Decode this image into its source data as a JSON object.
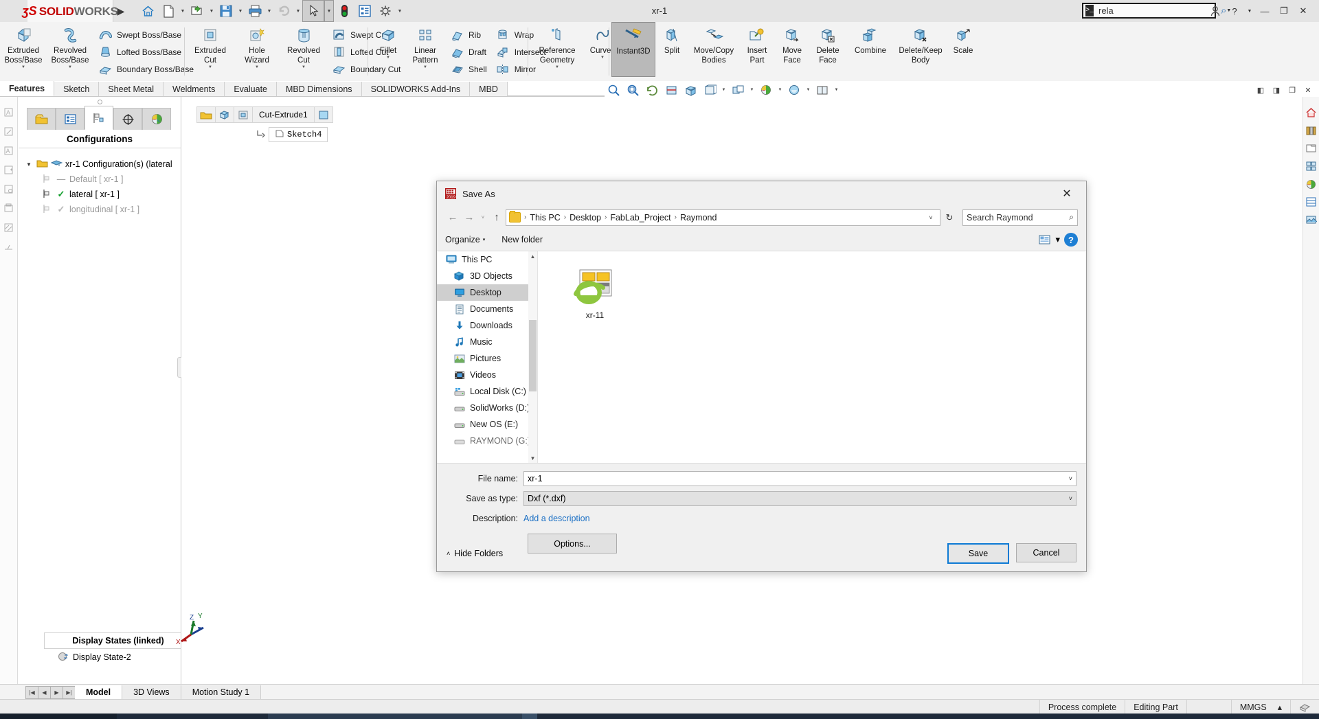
{
  "titlebar": {
    "brand_ds": "ʒS",
    "brand_solid": "SOLID",
    "brand_works": "WORKS",
    "document_title": "xr-1",
    "expand_arrow": "▶",
    "search_value": "rela",
    "quick_access": [
      {
        "name": "home-icon",
        "label": "Home"
      },
      {
        "name": "new-document-icon",
        "label": "New"
      },
      {
        "name": "open-folder-icon",
        "label": "Open"
      },
      {
        "name": "save-icon",
        "label": "Save"
      },
      {
        "name": "print-icon",
        "label": "Print"
      },
      {
        "name": "undo-icon",
        "label": "Undo"
      },
      {
        "name": "select-cursor-icon",
        "label": "Select"
      },
      {
        "name": "rebuild-icon",
        "label": "Rebuild"
      },
      {
        "name": "options-list-icon",
        "label": "File Properties"
      },
      {
        "name": "gear-icon",
        "label": "Options"
      }
    ],
    "window_controls": [
      "account-icon",
      "help-icon",
      "help-dropdown",
      "minimize",
      "restore",
      "close"
    ]
  },
  "ribbon": {
    "groups": [
      {
        "big": [
          {
            "label1": "Extruded",
            "label2": "Boss/Base",
            "icon": "extruded-boss-icon"
          },
          {
            "label1": "Revolved",
            "label2": "Boss/Base",
            "icon": "revolved-boss-icon"
          }
        ],
        "small": [
          {
            "label": "Swept Boss/Base",
            "icon": "swept-boss-icon"
          },
          {
            "label": "Lofted Boss/Base",
            "icon": "lofted-boss-icon"
          },
          {
            "label": "Boundary Boss/Base",
            "icon": "boundary-boss-icon"
          }
        ]
      },
      {
        "big": [
          {
            "label1": "Extruded",
            "label2": "Cut",
            "icon": "extruded-cut-icon"
          },
          {
            "label1": "Hole",
            "label2": "Wizard",
            "icon": "hole-wizard-icon"
          },
          {
            "label1": "Revolved",
            "label2": "Cut",
            "icon": "revolved-cut-icon"
          }
        ],
        "small": [
          {
            "label": "Swept Cut",
            "icon": "swept-cut-icon"
          },
          {
            "label": "Lofted Cut",
            "icon": "lofted-cut-icon"
          },
          {
            "label": "Boundary Cut",
            "icon": "boundary-cut-icon"
          }
        ]
      },
      {
        "big": [
          {
            "label1": "Fillet",
            "label2": "",
            "icon": "fillet-icon"
          },
          {
            "label1": "Linear",
            "label2": "Pattern",
            "icon": "linear-pattern-icon"
          }
        ],
        "small": [
          {
            "label": "Rib",
            "icon": "rib-icon"
          },
          {
            "label": "Draft",
            "icon": "draft-icon"
          },
          {
            "label": "Shell",
            "icon": "shell-icon"
          }
        ],
        "small2": [
          {
            "label": "Wrap",
            "icon": "wrap-icon"
          },
          {
            "label": "Intersect",
            "icon": "intersect-icon"
          },
          {
            "label": "Mirror",
            "icon": "mirror-icon"
          }
        ]
      },
      {
        "big": [
          {
            "label1": "Reference",
            "label2": "Geometry",
            "icon": "reference-geometry-icon"
          },
          {
            "label1": "Curves",
            "label2": "",
            "icon": "curves-icon"
          }
        ]
      },
      {
        "big": [
          {
            "label1": "Instant3D",
            "label2": "",
            "icon": "instant3d-icon",
            "active": true
          },
          {
            "label1": "Split",
            "label2": "",
            "icon": "split-icon"
          },
          {
            "label1": "Move/Copy",
            "label2": "Bodies",
            "icon": "move-copy-bodies-icon"
          },
          {
            "label1": "Insert",
            "label2": "Part",
            "icon": "insert-part-icon"
          },
          {
            "label1": "Move",
            "label2": "Face",
            "icon": "move-face-icon"
          },
          {
            "label1": "Delete",
            "label2": "Face",
            "icon": "delete-face-icon"
          },
          {
            "label1": "Combine",
            "label2": "",
            "icon": "combine-icon"
          },
          {
            "label1": "Delete/Keep",
            "label2": "Body",
            "icon": "delete-keep-body-icon"
          },
          {
            "label1": "Scale",
            "label2": "",
            "icon": "scale-icon"
          }
        ]
      }
    ],
    "tabs": [
      "Features",
      "Sketch",
      "Sheet Metal",
      "Weldments",
      "Evaluate",
      "MBD Dimensions",
      "SOLIDWORKS Add-Ins",
      "MBD"
    ]
  },
  "panel": {
    "tabs": [
      "feature-manager-tab",
      "property-manager-tab",
      "configuration-manager-tab",
      "dimxpert-tab",
      "display-manager-tab"
    ],
    "header": "Configurations",
    "tree": [
      {
        "label": "xr-1 Configuration(s)  (lateral",
        "state": "root"
      },
      {
        "label": "Default [ xr-1 ]",
        "state": "dim-dash"
      },
      {
        "label": "lateral [ xr-1 ]",
        "state": "active-check"
      },
      {
        "label": "longitudinal [ xr-1 ]",
        "state": "dim-check"
      }
    ],
    "display_states_header": "Display States (linked)",
    "display_state": "Display State-2"
  },
  "graphics": {
    "breadcrumb": [
      "part-icon",
      "body-icon",
      "cut-extrude-icon",
      "Cut-Extrude1",
      "face-icon"
    ],
    "breadcrumb_label": "Cut-Extrude1",
    "sketch_label": "Sketch4",
    "triad_axes": [
      "Z",
      "Y",
      "X"
    ]
  },
  "dialog": {
    "title": "Save As",
    "icon": "solidworks-2019-icon",
    "close_label": "✕",
    "nav": {
      "back": "←",
      "forward": "→",
      "recent_caret": "˅",
      "up": "↑",
      "breadcrumb": [
        "This PC",
        "Desktop",
        "FabLab_Project",
        "Raymond"
      ],
      "address_caret": "˅",
      "refresh": "↻",
      "search_placeholder": "Search Raymond"
    },
    "commands": {
      "organize": "Organize",
      "organize_caret": "▾",
      "new_folder": "New folder",
      "view_caret": "▾",
      "help": "?"
    },
    "nav_pane": [
      {
        "label": "This PC",
        "icon": "this-pc-icon",
        "level": 0,
        "selected": false
      },
      {
        "label": "3D Objects",
        "icon": "3d-objects-icon",
        "level": 1,
        "selected": false
      },
      {
        "label": "Desktop",
        "icon": "desktop-icon",
        "level": 1,
        "selected": true
      },
      {
        "label": "Documents",
        "icon": "documents-icon",
        "level": 1,
        "selected": false
      },
      {
        "label": "Downloads",
        "icon": "downloads-icon",
        "level": 1,
        "selected": false
      },
      {
        "label": "Music",
        "icon": "music-icon",
        "level": 1,
        "selected": false
      },
      {
        "label": "Pictures",
        "icon": "pictures-icon",
        "level": 1,
        "selected": false
      },
      {
        "label": "Videos",
        "icon": "videos-icon",
        "level": 1,
        "selected": false
      },
      {
        "label": "Local Disk (C:)",
        "icon": "local-disk-icon",
        "level": 1,
        "selected": false
      },
      {
        "label": "SolidWorks (D:)",
        "icon": "drive-icon",
        "level": 1,
        "selected": false
      },
      {
        "label": "New OS (E:)",
        "icon": "drive-icon",
        "level": 1,
        "selected": false
      },
      {
        "label": "RAYMOND (G:)",
        "icon": "drive-icon",
        "level": 1,
        "selected": false
      }
    ],
    "files": [
      {
        "name": "xr-11",
        "icon": "internet-explorer-html-icon"
      }
    ],
    "fields": {
      "file_name_label": "File name:",
      "file_name_value": "xr-1",
      "save_type_label": "Save as type:",
      "save_type_value": "Dxf (*.dxf)",
      "description_label": "Description:",
      "description_link": "Add a description",
      "caret": "˅"
    },
    "options_button": "Options...",
    "hide_folders": "Hide Folders",
    "hide_folders_caret": "˄",
    "save_button": "Save",
    "cancel_button": "Cancel"
  },
  "bottom": {
    "nav_buttons": [
      "⏮",
      "◀",
      "▶",
      "⏭"
    ],
    "tabs": [
      "Model",
      "3D Views",
      "Motion Study 1"
    ],
    "status": [
      "Process complete",
      "Editing Part",
      "MMGS",
      "▴"
    ]
  },
  "colors": {
    "brand_red": "#c00000",
    "accent_blue": "#0d7ad4",
    "link_blue": "#1a6fc4",
    "check_green": "#0f9d2a",
    "folder_yellow": "#f1c232"
  }
}
